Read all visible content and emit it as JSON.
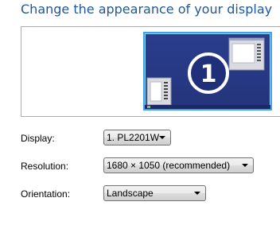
{
  "header": {
    "title": "Change the appearance of your display"
  },
  "preview": {
    "monitor_number": "1",
    "accent_color": "#3fa3e8",
    "screen_color": "#283a88"
  },
  "settings": {
    "display": {
      "label": "Display:",
      "value": "1. PL2201W"
    },
    "resolution": {
      "label": "Resolution:",
      "value": "1680 × 1050 (recommended)"
    },
    "orientation": {
      "label": "Orientation:",
      "value": "Landscape"
    }
  }
}
